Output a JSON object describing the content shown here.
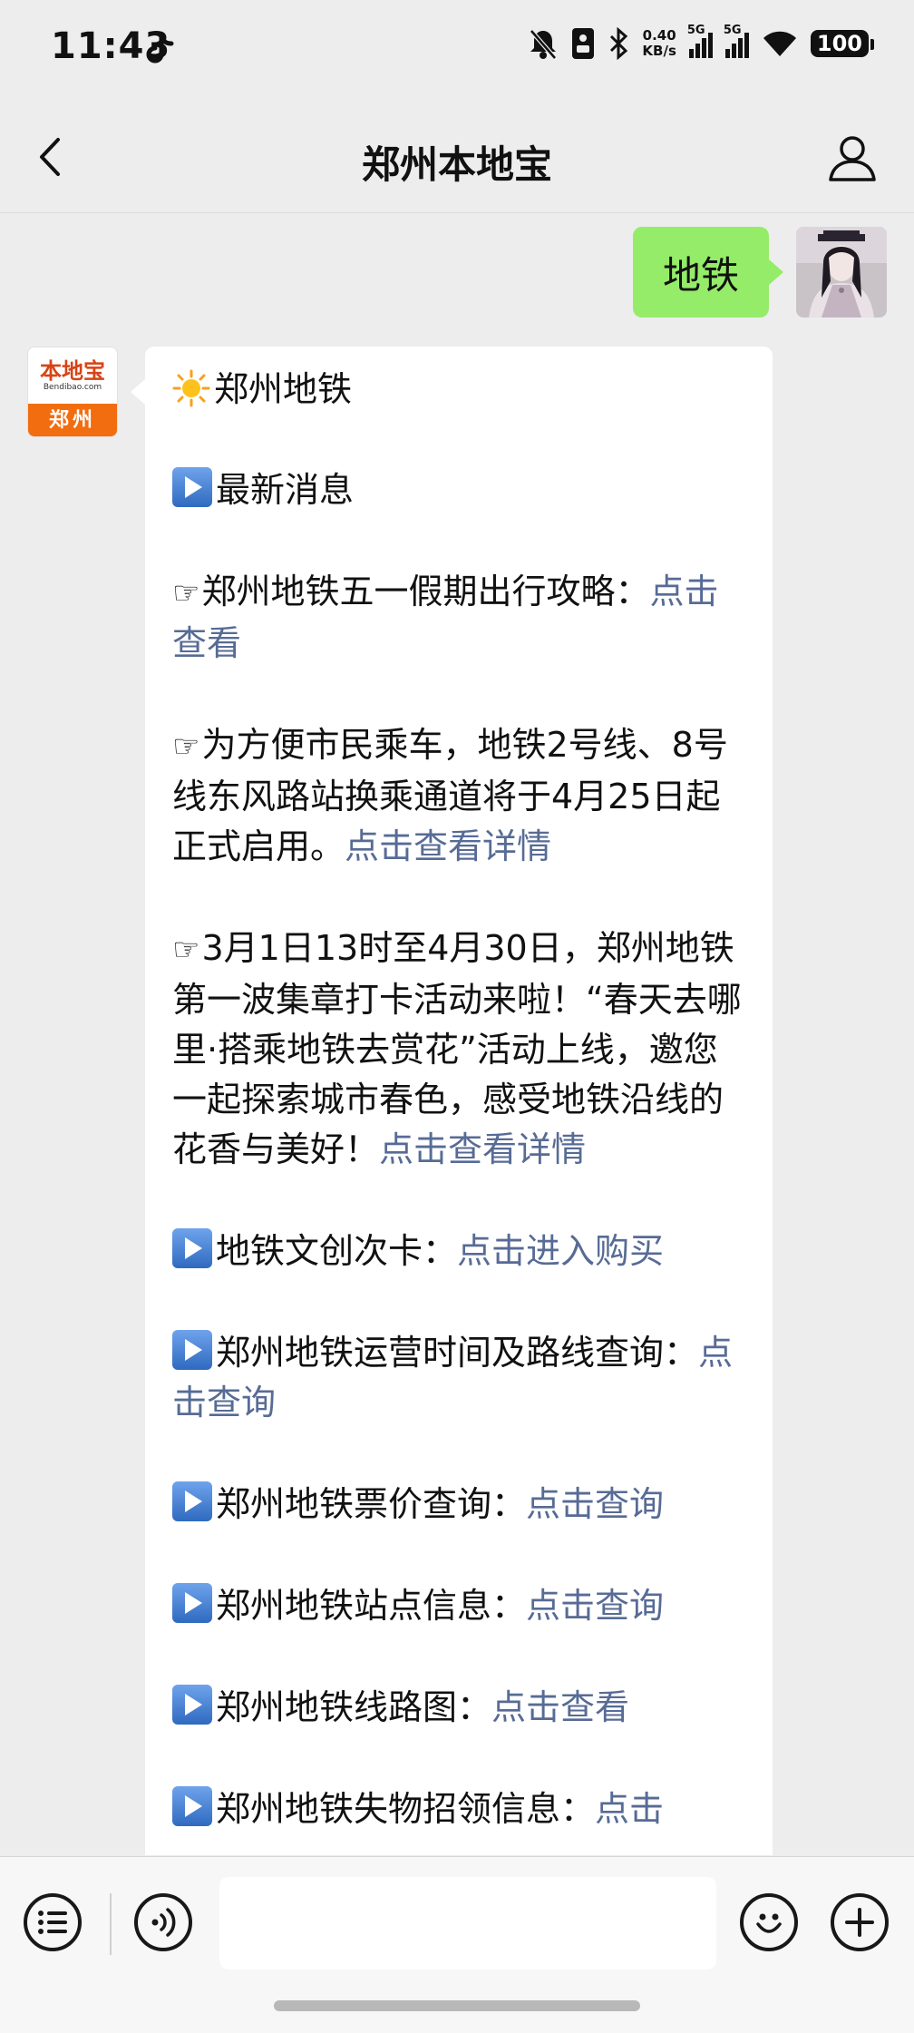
{
  "status_bar": {
    "time": "11:43",
    "net_speed_value": "0.40",
    "net_speed_unit": "KB/s",
    "sim1_label": "5G",
    "sim2_label": "5G",
    "battery": "100"
  },
  "header": {
    "title": "郑州本地宝"
  },
  "user_message": {
    "text": "地铁"
  },
  "bot_avatar": {
    "logo_text": "本地宝",
    "logo_sub": "Bendibao.com",
    "city": "郑州"
  },
  "bot_message": {
    "title": "郑州地铁",
    "latest_news": "最新消息",
    "news1_text": "郑州地铁五一假期出行攻略：",
    "news1_link": "点击查看",
    "news2_text": "为方便市民乘车，地铁2号线、8号线东风路站换乘通道将于4月25日起正式启用。",
    "news2_link": "点击查看详情",
    "news3_text": "3月1日13时至4月30日，郑州地铁第一波集章打卡活动来啦！“春天去哪里·搭乘地铁去赏花”活动上线，邀您一起探索城市春色，感受地铁沿线的花香与美好！",
    "news3_link": "点击查看详情",
    "card_text": "地铁文创次卡：",
    "card_link": "点击进入购买",
    "hours_text": "郑州地铁运营时间及路线查询：",
    "hours_link": "点击查询",
    "fare_text": "郑州地铁票价查询：",
    "fare_link": "点击查询",
    "station_text": "郑州地铁站点信息：",
    "station_link": "点击查询",
    "map_text": "郑州地铁线路图：",
    "map_link": "点击查看",
    "lost_text": "郑州地铁失物招领信息：",
    "lost_link": "点击"
  },
  "colors": {
    "link": "#576b95",
    "user_bubble": "#95ec69",
    "background": "#ededed"
  }
}
